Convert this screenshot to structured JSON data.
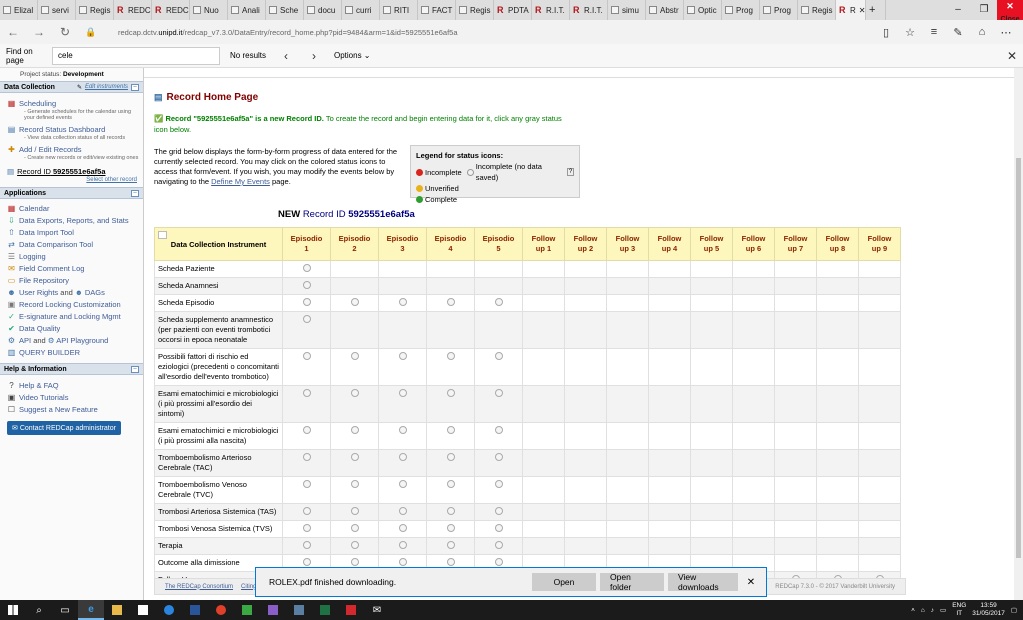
{
  "browser": {
    "tabs": [
      "Elizal",
      "servi",
      "Regis",
      "REDC",
      "REDC",
      "Nuo",
      "Anali",
      "Sche",
      "docu",
      "curri",
      "RITI",
      "FACT",
      "Regis",
      "PDTA",
      "R.I.T.",
      "R.I.T.",
      "simu",
      "Abstr",
      "Optic",
      "Prog",
      "Prog",
      "Regis",
      "R"
    ],
    "close_tooltip": "Close",
    "url_prefix": "redcap.dctv.",
    "url_domain": "unipd.it",
    "url_suffix": "/redcap_v7.3.0/DataEntry/record_home.php?pid=9484&arm=1&id=5925551e6af5a"
  },
  "findbar": {
    "label": "Find on page",
    "value": "cele",
    "result": "No results",
    "options": "Options"
  },
  "sidebar": {
    "project_status_label": "Project status:",
    "project_status": "Development",
    "data_collection": {
      "title": "Data Collection",
      "edit_link": "Edit instruments",
      "items": [
        {
          "label": "Scheduling",
          "desc": "- Generate schedules for the calendar using your defined events"
        },
        {
          "label": "Record Status Dashboard",
          "desc": "- View data collection status of all records"
        },
        {
          "label": "Add / Edit Records",
          "desc": "- Create new records or edit/view existing ones"
        }
      ],
      "record_prefix": "Record ID",
      "record_id": "5925551e6af5a",
      "select_other": "Select other record"
    },
    "applications": {
      "title": "Applications",
      "items": [
        "Calendar",
        "Data Exports, Reports, and Stats",
        "Data Import Tool",
        "Data Comparison Tool",
        "Logging",
        "Field Comment Log",
        "File Repository",
        "User Rights",
        "DAGs",
        "Record Locking Customization",
        "E-signature and Locking Mgmt",
        "Data Quality",
        "API",
        "API Playground",
        "QUERY BUILDER"
      ],
      "and": "and"
    },
    "help": {
      "title": "Help & Information",
      "items": [
        "Help & FAQ",
        "Video Tutorials",
        "Suggest a New Feature"
      ],
      "contact": "Contact REDCap administrator"
    }
  },
  "main": {
    "title": "Record Home Page",
    "new_record_bold": "Record \"5925551e6af5a\" is a new Record ID.",
    "new_record_rest": " To create the record and begin entering data for it, click any gray status icon below.",
    "intro_text": "The grid below displays the form-by-form progress of data entered for the currently selected record. You may click on the colored status icons to access that form/event. If you wish, you may modify the events below by navigating to the ",
    "intro_link": "Define My Events",
    "intro_end": " page.",
    "legend": {
      "title": "Legend for status icons:",
      "incomplete": "Incomplete",
      "incomplete_nodata": "Incomplete (no data saved)",
      "unverified": "Unverified",
      "complete": "Complete",
      "colors": {
        "incomplete": "#d9261c",
        "unverified": "#e8b21c",
        "complete": "#2f9e2f"
      }
    },
    "record_title_new": "NEW",
    "record_title_prefix": "Record ID",
    "record_title_id": "5925551e6af5a",
    "grid": {
      "instrument_header": "Data Collection Instrument",
      "events": [
        [
          "Episodio",
          "1"
        ],
        [
          "Episodio",
          "2"
        ],
        [
          "Episodio",
          "3"
        ],
        [
          "Episodio",
          "4"
        ],
        [
          "Episodio",
          "5"
        ],
        [
          "Follow",
          "up 1"
        ],
        [
          "Follow",
          "up 2"
        ],
        [
          "Follow",
          "up 3"
        ],
        [
          "Follow",
          "up 4"
        ],
        [
          "Follow",
          "up 5"
        ],
        [
          "Follow",
          "up 6"
        ],
        [
          "Follow",
          "up 7"
        ],
        [
          "Follow",
          "up 8"
        ],
        [
          "Follow",
          "up 9"
        ]
      ],
      "rows": [
        {
          "name": "Scheda Paziente",
          "cols": [
            0
          ]
        },
        {
          "name": "Scheda Anamnesi",
          "cols": [
            0
          ]
        },
        {
          "name": "Scheda Episodio",
          "cols": [
            0,
            1,
            2,
            3,
            4
          ]
        },
        {
          "name": "Scheda supplemento anamnestico (per pazienti con eventi trombotici occorsi in epoca neonatale",
          "cols": [
            0
          ]
        },
        {
          "name": "Possibili fattori di rischio ed eziologici (precedenti o concomitanti all'esordio dell'evento trombotico)",
          "cols": [
            0,
            1,
            2,
            3,
            4
          ]
        },
        {
          "name": "Esami ematochimici e microbiologici (i più prossimi all'esordio dei sintomi)",
          "cols": [
            0,
            1,
            2,
            3,
            4
          ]
        },
        {
          "name": "Esami ematochimici e microbiologici (i più prossimi alla nascita)",
          "cols": [
            0,
            1,
            2,
            3,
            4
          ]
        },
        {
          "name": "Tromboembolismo Arterioso Cerebrale (TAC)",
          "cols": [
            0,
            1,
            2,
            3,
            4
          ]
        },
        {
          "name": "Tromboembolismo Venoso Cerebrale (TVC)",
          "cols": [
            0,
            1,
            2,
            3,
            4
          ]
        },
        {
          "name": "Trombosi Arteriosa Sistemica (TAS)",
          "cols": [
            0,
            1,
            2,
            3,
            4
          ]
        },
        {
          "name": "Trombosi Venosa Sistemica (TVS)",
          "cols": [
            0,
            1,
            2,
            3,
            4
          ]
        },
        {
          "name": "Terapia",
          "cols": [
            0,
            1,
            2,
            3,
            4
          ]
        },
        {
          "name": "Outcome alla dimissione",
          "cols": [
            0,
            1,
            2,
            3,
            4
          ]
        },
        {
          "name": "Follow Up",
          "cols": [
            5,
            6,
            7,
            8,
            9,
            10,
            11,
            12,
            13
          ]
        }
      ]
    },
    "footer": {
      "consortium": "The REDCap Consortium",
      "citing": "Citing",
      "version": "REDCap 7.3.0 - © 2017 Vanderbilt University"
    }
  },
  "download": {
    "message": "ROLEX.pdf finished downloading.",
    "open": "Open",
    "open_folder": "Open folder",
    "view": "View downloads"
  },
  "taskbar": {
    "lang": "ENG",
    "region": "IT",
    "time": "13:59",
    "date": "31/05/2017"
  }
}
